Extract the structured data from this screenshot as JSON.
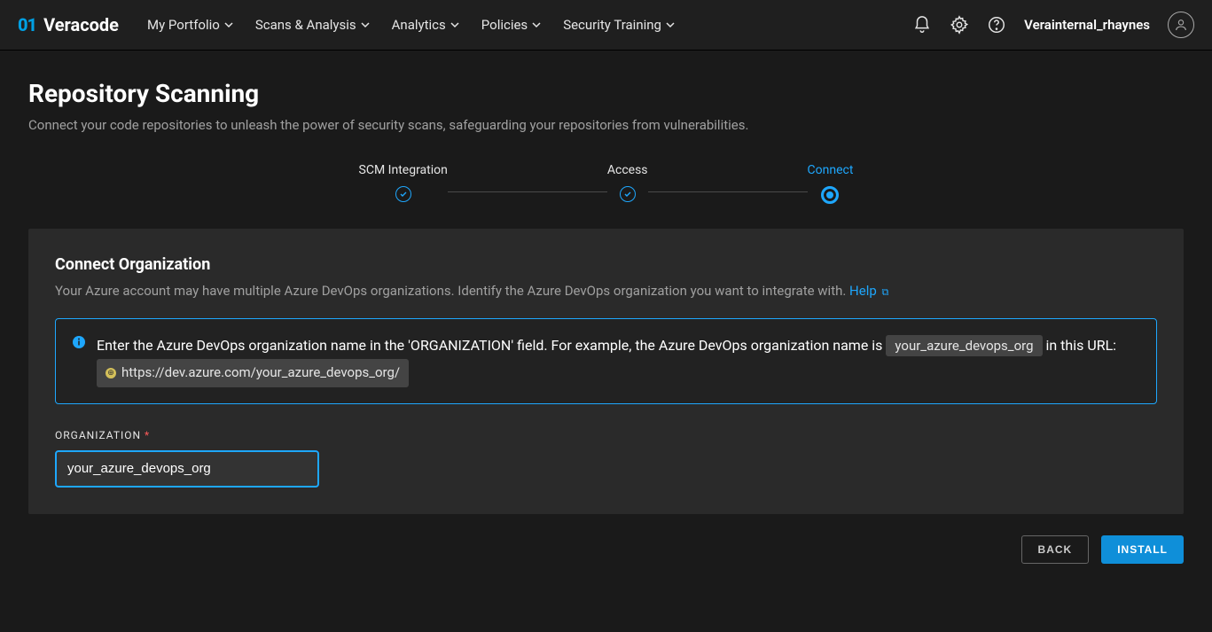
{
  "brand": {
    "mark": "01",
    "name": "Veracode"
  },
  "nav": {
    "items": [
      {
        "label": "My Portfolio"
      },
      {
        "label": "Scans & Analysis"
      },
      {
        "label": "Analytics"
      },
      {
        "label": "Policies"
      },
      {
        "label": "Security Training"
      }
    ]
  },
  "user": {
    "name": "Verainternal_rhaynes"
  },
  "page": {
    "title": "Repository Scanning",
    "subtitle": "Connect your code repositories to unleash the power of security scans, safeguarding your repositories from vulnerabilities."
  },
  "stepper": {
    "steps": [
      {
        "label": "SCM Integration"
      },
      {
        "label": "Access"
      },
      {
        "label": "Connect"
      }
    ]
  },
  "card": {
    "title": "Connect Organization",
    "subtitle": "Your Azure account may have multiple Azure DevOps organizations. Identify the Azure DevOps organization you want to integrate with. ",
    "help_label": "Help",
    "info_prefix": "Enter the Azure DevOps organization name in the 'ORGANIZATION' field. For example, the Azure DevOps organization name is ",
    "info_org_chip": "your_azure_devops_org",
    "info_mid": " in this URL: ",
    "info_url": "https://dev.azure.com/your_azure_devops_org/",
    "field_label": "ORGANIZATION",
    "required_mark": "*",
    "field_value": "your_azure_devops_org"
  },
  "buttons": {
    "back": "BACK",
    "install": "INSTALL"
  }
}
